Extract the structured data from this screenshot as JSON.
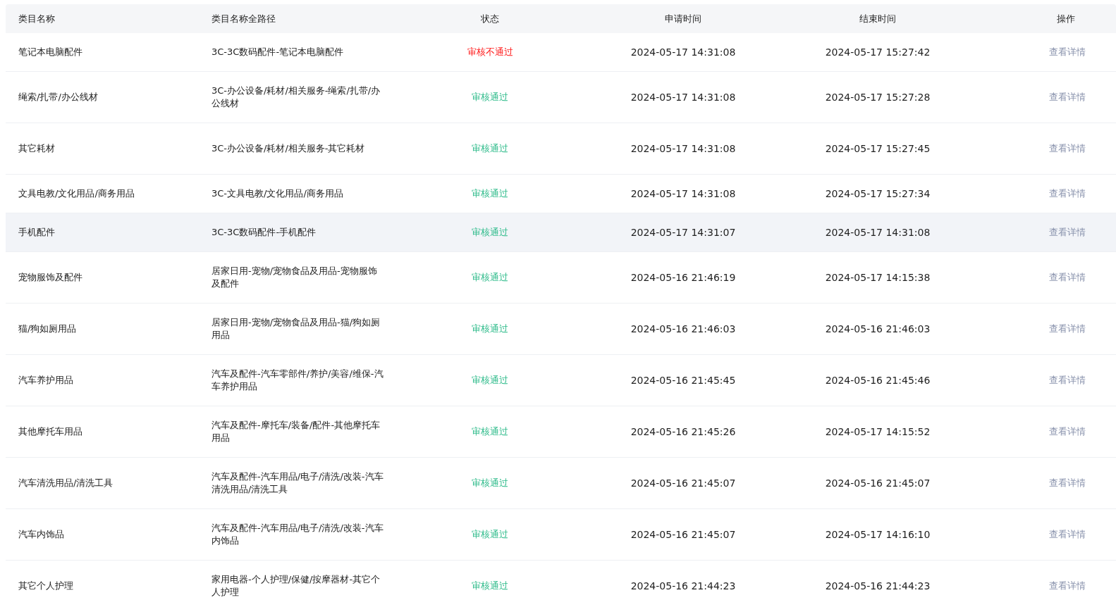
{
  "table": {
    "columns": [
      "类目名称",
      "类目名称全路径",
      "状态",
      "申请时间",
      "结束时间",
      "操作"
    ],
    "rows": [
      {
        "name": "笔记本电脑配件",
        "path": "3C-3C数码配件-笔记本电脑配件",
        "status": {
          "text": "审核不通过",
          "kind": "rejected"
        },
        "applied": "2024-05-17 14:31:08",
        "ended": "2024-05-17 15:27:42",
        "action": "查看详情",
        "hovered": false
      },
      {
        "name": "绳索/扎带/办公线材",
        "path": "3C-办公设备/耗材/相关服务-绳索/扎带/办公线材",
        "status": {
          "text": "审核通过",
          "kind": "approved"
        },
        "applied": "2024-05-17 14:31:08",
        "ended": "2024-05-17 15:27:28",
        "action": "查看详情",
        "hovered": false
      },
      {
        "name": "其它耗材",
        "path": "3C-办公设备/耗材/相关服务-其它耗材",
        "status": {
          "text": "审核通过",
          "kind": "approved"
        },
        "applied": "2024-05-17 14:31:08",
        "ended": "2024-05-17 15:27:45",
        "action": "查看详情",
        "hovered": false
      },
      {
        "name": "文具电教/文化用品/商务用品",
        "path": "3C-文具电教/文化用品/商务用品",
        "status": {
          "text": "审核通过",
          "kind": "approved"
        },
        "applied": "2024-05-17 14:31:08",
        "ended": "2024-05-17 15:27:34",
        "action": "查看详情",
        "hovered": false
      },
      {
        "name": "手机配件",
        "path": "3C-3C数码配件-手机配件",
        "status": {
          "text": "审核通过",
          "kind": "approved"
        },
        "applied": "2024-05-17 14:31:07",
        "ended": "2024-05-17 14:31:08",
        "action": "查看详情",
        "hovered": true
      },
      {
        "name": "宠物服饰及配件",
        "path": "居家日用-宠物/宠物食品及用品-宠物服饰及配件",
        "status": {
          "text": "审核通过",
          "kind": "approved"
        },
        "applied": "2024-05-16 21:46:19",
        "ended": "2024-05-17 14:15:38",
        "action": "查看详情",
        "hovered": false
      },
      {
        "name": "猫/狗如厕用品",
        "path": "居家日用-宠物/宠物食品及用品-猫/狗如厕用品",
        "status": {
          "text": "审核通过",
          "kind": "approved"
        },
        "applied": "2024-05-16 21:46:03",
        "ended": "2024-05-16 21:46:03",
        "action": "查看详情",
        "hovered": false
      },
      {
        "name": "汽车养护用品",
        "path": "汽车及配件-汽车零部件/养护/美容/维保-汽车养护用品",
        "status": {
          "text": "审核通过",
          "kind": "approved"
        },
        "applied": "2024-05-16 21:45:45",
        "ended": "2024-05-16 21:45:46",
        "action": "查看详情",
        "hovered": false
      },
      {
        "name": "其他摩托车用品",
        "path": "汽车及配件-摩托车/装备/配件-其他摩托车用品",
        "status": {
          "text": "审核通过",
          "kind": "approved"
        },
        "applied": "2024-05-16 21:45:26",
        "ended": "2024-05-17 14:15:52",
        "action": "查看详情",
        "hovered": false
      },
      {
        "name": "汽车清洗用品/清洗工具",
        "path": "汽车及配件-汽车用品/电子/清洗/改装-汽车清洗用品/清洗工具",
        "status": {
          "text": "审核通过",
          "kind": "approved"
        },
        "applied": "2024-05-16 21:45:07",
        "ended": "2024-05-16 21:45:07",
        "action": "查看详情",
        "hovered": false
      },
      {
        "name": "汽车内饰品",
        "path": "汽车及配件-汽车用品/电子/清洗/改装-汽车内饰品",
        "status": {
          "text": "审核通过",
          "kind": "approved"
        },
        "applied": "2024-05-16 21:45:07",
        "ended": "2024-05-17 14:16:10",
        "action": "查看详情",
        "hovered": false
      },
      {
        "name": "其它个人护理",
        "path": "家用电器-个人护理/保健/按摩器材-其它个人护理",
        "status": {
          "text": "审核通过",
          "kind": "approved"
        },
        "applied": "2024-05-16 21:44:23",
        "ended": "2024-05-16 21:44:23",
        "action": "查看详情",
        "hovered": false
      }
    ]
  }
}
